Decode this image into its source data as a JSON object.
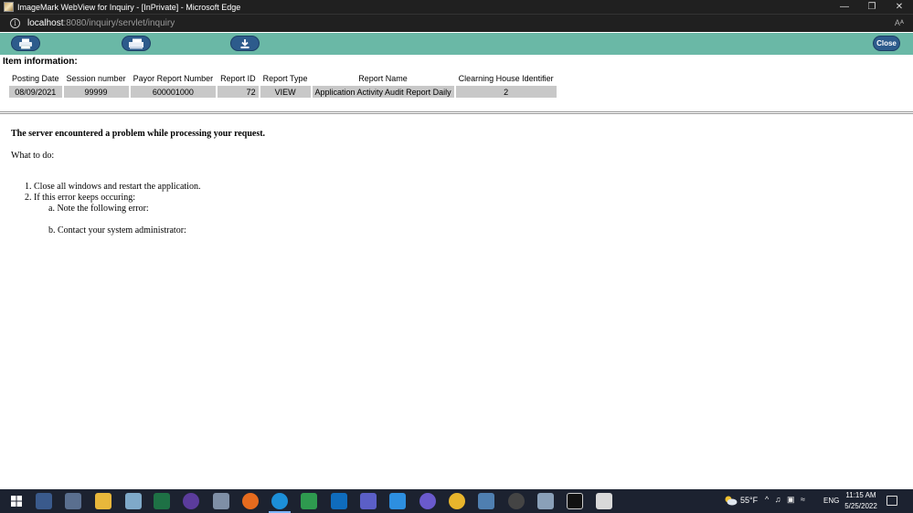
{
  "window": {
    "title": "ImageMark WebView for Inquiry - [InPrivate] - Microsoft Edge",
    "controls": [
      "minimize-icon",
      "restore-icon",
      "close-icon"
    ]
  },
  "address": {
    "host": "localhost",
    "path": ":8080/inquiry/servlet/inquiry",
    "read_aloud": "Aᴬ"
  },
  "toolbar": {
    "buttons": [
      {
        "icon": "print-icon"
      },
      {
        "icon": "fax-icon"
      },
      {
        "icon": "download-icon"
      }
    ],
    "close_label": "Close",
    "color": "#6ab8a6",
    "button_color": "#2d5b8c"
  },
  "item_info": {
    "heading": "Item information:",
    "columns": [
      "Posting Date",
      "Session number",
      "Payor Report Number",
      "Report ID",
      "Report Type",
      "Report Name",
      "Clearning House Identifier"
    ],
    "rows": [
      [
        "08/09/2021",
        "99999",
        "600001000",
        "72",
        "VIEW",
        "Application Activity Audit Report Daily",
        "2"
      ]
    ]
  },
  "error": {
    "headline": "The server encountered a problem while processing your request.",
    "what_to_do": "What to do:",
    "step1": "1. Close all windows and restart the application.",
    "step2": "2. If this error keeps occuring:",
    "step2a": "a. Note the following error:",
    "step2b": "b. Contact your system administrator:"
  },
  "taskbar": {
    "apps": [
      "windows-start-icon",
      "calculator-icon",
      "paint-icon",
      "file-explorer-icon",
      "notepad-icon",
      "excel-icon",
      "github-icon",
      "app-icon",
      "firefox-icon",
      "edge-icon",
      "sheets-icon",
      "outlook-icon",
      "teams-icon",
      "vscode-icon",
      "app-icon",
      "chrome-icon",
      "app-icon",
      "settings-icon",
      "app-icon",
      "terminal-icon",
      "java-icon"
    ],
    "weather": "55°F",
    "language": "ENG",
    "time": "11:15 AM",
    "date": "5/25/2022"
  }
}
